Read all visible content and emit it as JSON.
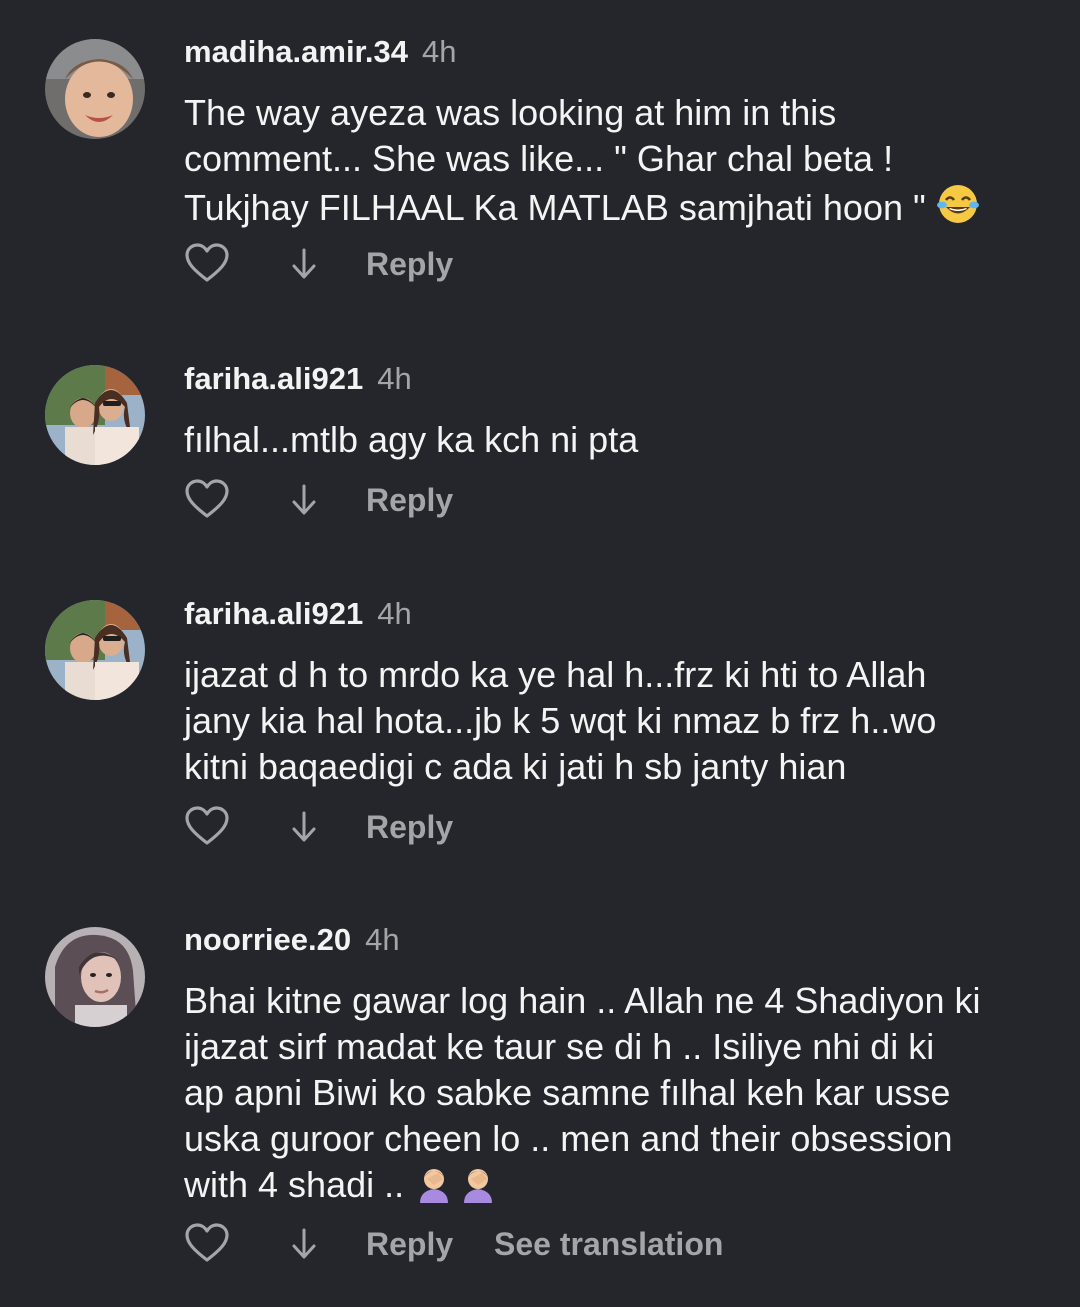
{
  "comments": [
    {
      "username": "madiha.amir.34",
      "time": "4h",
      "text": "The way ayeza was looking at him in this\ncomment... She was like... \" Ghar chal beta !\nTukjhay FILHAAL Ka MATLAB samjhati hoon \" ",
      "emoji": "face-with-tears-of-joy",
      "reply_label": "Reply"
    },
    {
      "username": "fariha.ali921",
      "time": "4h",
      "text": "fılhal...mtlb agy ka kch ni pta",
      "reply_label": "Reply"
    },
    {
      "username": "fariha.ali921",
      "time": "4h",
      "text": "ijazat d h to mrdo ka ye hal h...frz ki hti to Allah\njany kia hal hota...jb k 5 wqt ki nmaz b frz h..wo\nkitni baqaedigi c ada ki jati h sb janty hian",
      "reply_label": "Reply"
    },
    {
      "username": "noorriee.20",
      "time": "4h",
      "text": "Bhai kitne gawar log hain .. Allah ne 4 Shadiyon ki\nijazat sirf madat ke taur se di h .. Isiliye nhi di ki\nap apni Biwi ko sabke samne fılhal keh kar usse\nuska guroor cheen lo .. men and their obsession\nwith 4 shadi .. ",
      "emoji": "person-facepalming",
      "reply_label": "Reply",
      "see_translation_label": "See translation"
    }
  ],
  "colors": {
    "background": "#25262b",
    "text": "#f4f4f4",
    "muted": "#a4a5a9"
  }
}
